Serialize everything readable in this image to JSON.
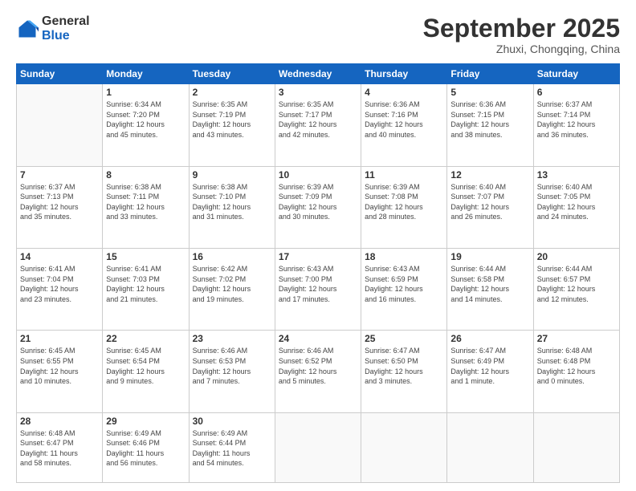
{
  "logo": {
    "general": "General",
    "blue": "Blue"
  },
  "header": {
    "month": "September 2025",
    "location": "Zhuxi, Chongqing, China"
  },
  "weekdays": [
    "Sunday",
    "Monday",
    "Tuesday",
    "Wednesday",
    "Thursday",
    "Friday",
    "Saturday"
  ],
  "weeks": [
    [
      {
        "day": "",
        "info": ""
      },
      {
        "day": "1",
        "info": "Sunrise: 6:34 AM\nSunset: 7:20 PM\nDaylight: 12 hours\nand 45 minutes."
      },
      {
        "day": "2",
        "info": "Sunrise: 6:35 AM\nSunset: 7:19 PM\nDaylight: 12 hours\nand 43 minutes."
      },
      {
        "day": "3",
        "info": "Sunrise: 6:35 AM\nSunset: 7:17 PM\nDaylight: 12 hours\nand 42 minutes."
      },
      {
        "day": "4",
        "info": "Sunrise: 6:36 AM\nSunset: 7:16 PM\nDaylight: 12 hours\nand 40 minutes."
      },
      {
        "day": "5",
        "info": "Sunrise: 6:36 AM\nSunset: 7:15 PM\nDaylight: 12 hours\nand 38 minutes."
      },
      {
        "day": "6",
        "info": "Sunrise: 6:37 AM\nSunset: 7:14 PM\nDaylight: 12 hours\nand 36 minutes."
      }
    ],
    [
      {
        "day": "7",
        "info": "Sunrise: 6:37 AM\nSunset: 7:13 PM\nDaylight: 12 hours\nand 35 minutes."
      },
      {
        "day": "8",
        "info": "Sunrise: 6:38 AM\nSunset: 7:11 PM\nDaylight: 12 hours\nand 33 minutes."
      },
      {
        "day": "9",
        "info": "Sunrise: 6:38 AM\nSunset: 7:10 PM\nDaylight: 12 hours\nand 31 minutes."
      },
      {
        "day": "10",
        "info": "Sunrise: 6:39 AM\nSunset: 7:09 PM\nDaylight: 12 hours\nand 30 minutes."
      },
      {
        "day": "11",
        "info": "Sunrise: 6:39 AM\nSunset: 7:08 PM\nDaylight: 12 hours\nand 28 minutes."
      },
      {
        "day": "12",
        "info": "Sunrise: 6:40 AM\nSunset: 7:07 PM\nDaylight: 12 hours\nand 26 minutes."
      },
      {
        "day": "13",
        "info": "Sunrise: 6:40 AM\nSunset: 7:05 PM\nDaylight: 12 hours\nand 24 minutes."
      }
    ],
    [
      {
        "day": "14",
        "info": "Sunrise: 6:41 AM\nSunset: 7:04 PM\nDaylight: 12 hours\nand 23 minutes."
      },
      {
        "day": "15",
        "info": "Sunrise: 6:41 AM\nSunset: 7:03 PM\nDaylight: 12 hours\nand 21 minutes."
      },
      {
        "day": "16",
        "info": "Sunrise: 6:42 AM\nSunset: 7:02 PM\nDaylight: 12 hours\nand 19 minutes."
      },
      {
        "day": "17",
        "info": "Sunrise: 6:43 AM\nSunset: 7:00 PM\nDaylight: 12 hours\nand 17 minutes."
      },
      {
        "day": "18",
        "info": "Sunrise: 6:43 AM\nSunset: 6:59 PM\nDaylight: 12 hours\nand 16 minutes."
      },
      {
        "day": "19",
        "info": "Sunrise: 6:44 AM\nSunset: 6:58 PM\nDaylight: 12 hours\nand 14 minutes."
      },
      {
        "day": "20",
        "info": "Sunrise: 6:44 AM\nSunset: 6:57 PM\nDaylight: 12 hours\nand 12 minutes."
      }
    ],
    [
      {
        "day": "21",
        "info": "Sunrise: 6:45 AM\nSunset: 6:55 PM\nDaylight: 12 hours\nand 10 minutes."
      },
      {
        "day": "22",
        "info": "Sunrise: 6:45 AM\nSunset: 6:54 PM\nDaylight: 12 hours\nand 9 minutes."
      },
      {
        "day": "23",
        "info": "Sunrise: 6:46 AM\nSunset: 6:53 PM\nDaylight: 12 hours\nand 7 minutes."
      },
      {
        "day": "24",
        "info": "Sunrise: 6:46 AM\nSunset: 6:52 PM\nDaylight: 12 hours\nand 5 minutes."
      },
      {
        "day": "25",
        "info": "Sunrise: 6:47 AM\nSunset: 6:50 PM\nDaylight: 12 hours\nand 3 minutes."
      },
      {
        "day": "26",
        "info": "Sunrise: 6:47 AM\nSunset: 6:49 PM\nDaylight: 12 hours\nand 1 minute."
      },
      {
        "day": "27",
        "info": "Sunrise: 6:48 AM\nSunset: 6:48 PM\nDaylight: 12 hours\nand 0 minutes."
      }
    ],
    [
      {
        "day": "28",
        "info": "Sunrise: 6:48 AM\nSunset: 6:47 PM\nDaylight: 11 hours\nand 58 minutes."
      },
      {
        "day": "29",
        "info": "Sunrise: 6:49 AM\nSunset: 6:46 PM\nDaylight: 11 hours\nand 56 minutes."
      },
      {
        "day": "30",
        "info": "Sunrise: 6:49 AM\nSunset: 6:44 PM\nDaylight: 11 hours\nand 54 minutes."
      },
      {
        "day": "",
        "info": ""
      },
      {
        "day": "",
        "info": ""
      },
      {
        "day": "",
        "info": ""
      },
      {
        "day": "",
        "info": ""
      }
    ]
  ]
}
